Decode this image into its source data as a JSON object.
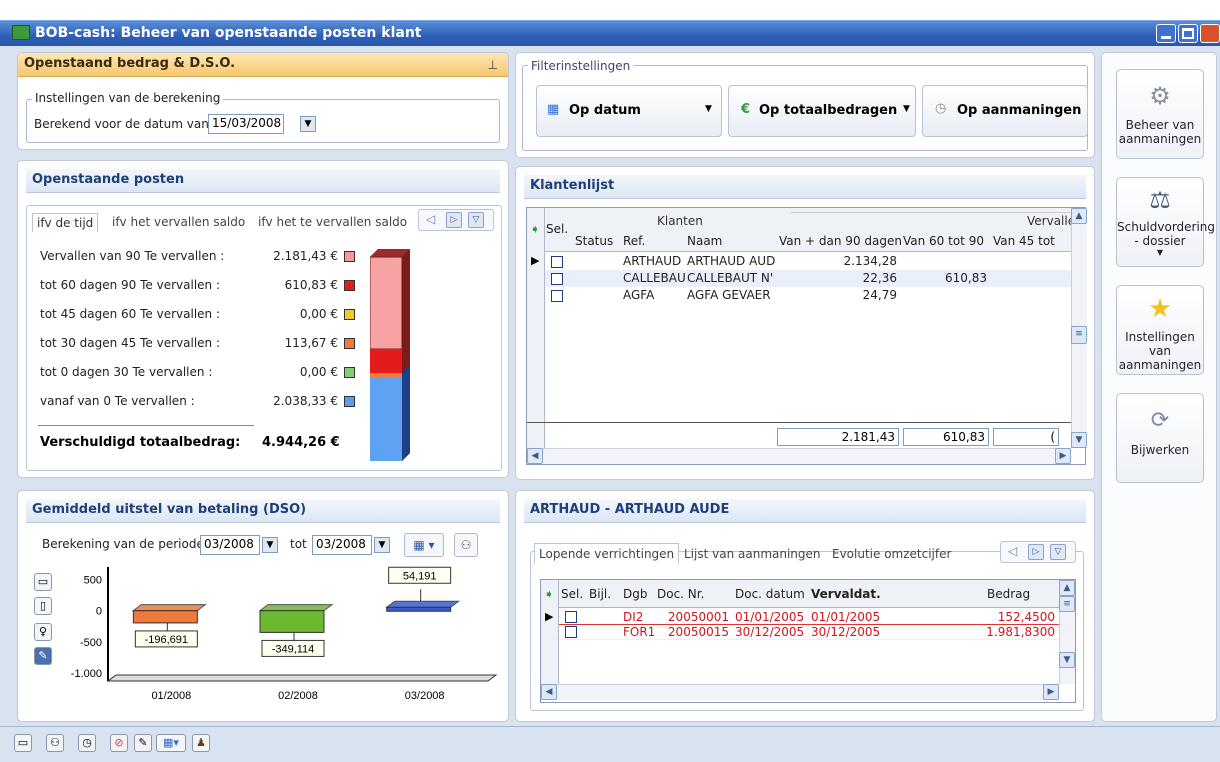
{
  "window": {
    "title": "BOB-cash: Beheer van openstaande posten klant"
  },
  "dso_panel": {
    "title": "Openstaand bedrag & D.S.O.",
    "group_label": "Instellingen van de berekening",
    "calc_date_label": "Berekend voor de datum van",
    "calc_date_value": "15/03/2008"
  },
  "filter": {
    "group_label": "Filterinstellingen",
    "btn_date": "Op datum",
    "btn_total": "Op totaalbedragen",
    "btn_reminders": "Op aanmaningen"
  },
  "open_items": {
    "title": "Openstaande posten",
    "tabs": [
      "ifv de tijd",
      "ifv het vervallen saldo",
      "ifv het te vervallen saldo"
    ],
    "rows": [
      {
        "label": "Vervallen van 90 Te vervallen :",
        "value": "2.181,43 €",
        "color": "#f29a9a"
      },
      {
        "label": "tot 60 dagen 90 Te vervallen :",
        "value": "610,83 €",
        "color": "#e41b1b"
      },
      {
        "label": "tot 45 dagen 60 Te vervallen :",
        "value": "0,00 €",
        "color": "#f5c731"
      },
      {
        "label": "tot 30 dagen 45 Te vervallen :",
        "value": "113,67 €",
        "color": "#f07a3c"
      },
      {
        "label": "tot 0 dagen 30 Te vervallen :",
        "value": "0,00 €",
        "color": "#7fcf6e"
      },
      {
        "label": "vanaf van 0 Te vervallen :",
        "value": "2.038,33 €",
        "color": "#5b9bf0"
      }
    ],
    "total_label": "Verschuldigd totaalbedrag:",
    "total_value": "4.944,26 €"
  },
  "klanten": {
    "title": "Klantenlijst",
    "group_header_klanten": "Klanten",
    "group_header_verval": "Vervalle",
    "columns": [
      "Sel.",
      "Status",
      "Ref.",
      "Naam",
      "Van + dan 90 dagen",
      "Van 60 tot 90",
      "Van 45 tot"
    ],
    "rows": [
      {
        "ref": "ARTHAUD",
        "name": "ARTHAUD AUD",
        "v90": "2.134,28",
        "v60": "",
        "v45": ""
      },
      {
        "ref": "CALLEBAU",
        "name": "CALLEBAUT N'",
        "v90": "22,36",
        "v60": "610,83",
        "v45": ""
      },
      {
        "ref": "AGFA",
        "name": "AGFA GEVAER",
        "v90": "24,79",
        "v60": "",
        "v45": ""
      }
    ],
    "totals": {
      "v90": "2.181,43",
      "v60": "610,83",
      "v45": "("
    }
  },
  "dso": {
    "title": "Gemiddeld uitstel van betaling (DSO)",
    "period_label": "Berekening van de periode",
    "period_from": "03/2008",
    "to_label": "tot",
    "period_to": "03/2008"
  },
  "chart_data": {
    "type": "bar",
    "categories": [
      "01/2008",
      "02/2008",
      "03/2008"
    ],
    "values": [
      -196.691,
      -349.114,
      54.191
    ],
    "value_labels": [
      "-196,691",
      "-349,114",
      "54,191"
    ],
    "yticks": [
      "500",
      "0",
      "-500",
      "-1.000"
    ],
    "colors": [
      "#f07a3c",
      "#6cb82e",
      "#3b5bd1"
    ],
    "ylim": [
      -1000,
      700
    ]
  },
  "detail": {
    "title": "ARTHAUD - ARTHAUD AUDE",
    "tabs": [
      "Lopende verrichtingen",
      "Lijst van aanmaningen",
      "Evolutie omzetcijfer"
    ],
    "columns": [
      "Sel.",
      "Bijl.",
      "Dgb",
      "Doc. Nr.",
      "Doc. datum",
      "Vervaldat.",
      "Bedrag"
    ],
    "rows": [
      {
        "dgb": "DI2",
        "nr": "20050001",
        "date": "01/01/2005",
        "due": "01/01/2005",
        "amount": "152,4500"
      },
      {
        "dgb": "FOR1",
        "nr": "20050015",
        "date": "30/12/2005",
        "due": "30/12/2005",
        "amount": "1.981,8300"
      }
    ]
  },
  "side": {
    "btn1": "Beheer van aanmaningen",
    "btn2": "Schuldvordering - dossier",
    "btn3": "Instellingen van aanmaningen",
    "btn4": "Bijwerken"
  }
}
